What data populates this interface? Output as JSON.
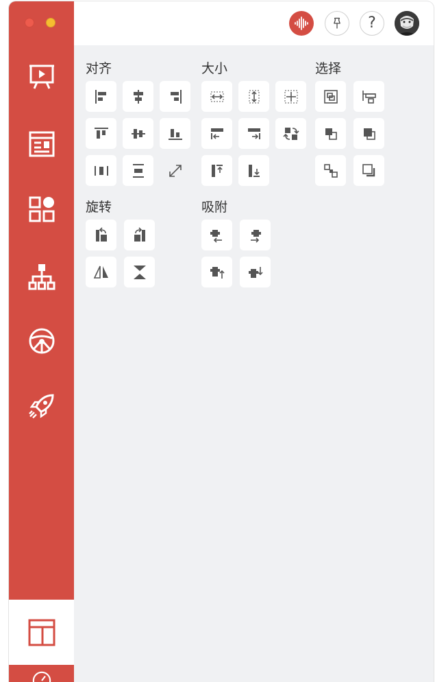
{
  "window": {
    "controls": [
      "close",
      "minimize"
    ]
  },
  "sidebar": {
    "items": [
      {
        "name": "presentation",
        "icon": "presentation-board-icon"
      },
      {
        "name": "news",
        "icon": "newspaper-icon"
      },
      {
        "name": "components",
        "icon": "components-grid-icon"
      },
      {
        "name": "hierarchy",
        "icon": "org-chart-icon"
      },
      {
        "name": "steering",
        "icon": "steering-wheel-icon"
      },
      {
        "name": "launch",
        "icon": "rocket-icon"
      },
      {
        "name": "layout",
        "icon": "layout-icon",
        "active": true
      },
      {
        "name": "more",
        "icon": "compass-icon"
      }
    ],
    "accent": "#d44d43"
  },
  "header": {
    "buttons": [
      "voice-icon",
      "pin-icon",
      "help-icon",
      "avatar"
    ],
    "help_label": "?"
  },
  "sections": {
    "align": {
      "title": "对齐"
    },
    "size": {
      "title": "大小"
    },
    "select": {
      "title": "选择"
    },
    "rotate": {
      "title": "旋转"
    },
    "snap": {
      "title": "吸附"
    }
  }
}
